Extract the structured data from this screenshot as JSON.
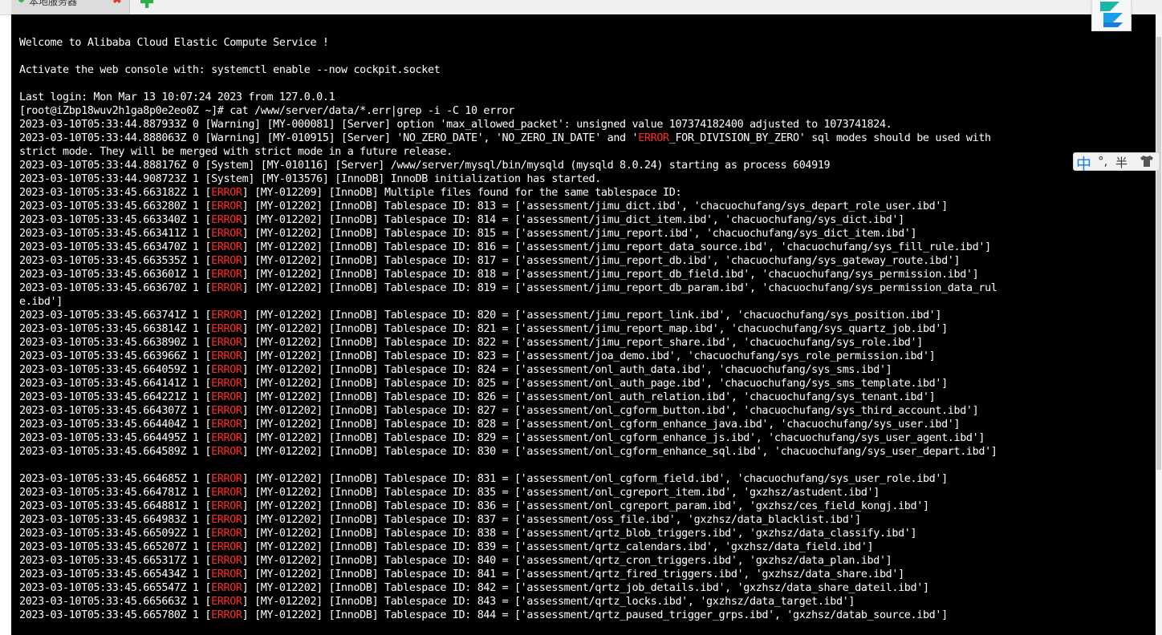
{
  "tab": {
    "title": "本地服务器",
    "close_glyph": "✖",
    "add_glyph": "✚",
    "status_color": "#3cb24a"
  },
  "ime": {
    "mode": "中",
    "punct": "°,",
    "width": "半"
  },
  "colors": {
    "terminal_bg": "#000000",
    "terminal_fg": "#ffffff",
    "error_highlight": "#ff2c2c"
  },
  "terminal": {
    "lines": [
      "Welcome to Alibaba Cloud Elastic Compute Service !",
      "",
      "Activate the web console with: systemctl enable --now cockpit.socket",
      "",
      "Last login: Mon Mar 13 10:07:24 2023 from 127.0.0.1",
      "[root@iZbp18wuv2h1ga8p0e2eo0Z ~]# cat /www/server/data/*.err|grep -i -C 10 error",
      "2023-03-10T05:33:44.887933Z 0 [Warning] [MY-000081] [Server] option 'max_allowed_packet': unsigned value 107374182400 adjusted to 1073741824.",
      "2023-03-10T05:33:44.888063Z 0 [Warning] [MY-010915] [Server] 'NO_ZERO_DATE', 'NO_ZERO_IN_DATE' and 'ERROR_FOR_DIVISION_BY_ZERO' sql modes should be used with",
      "strict mode. They will be merged with strict mode in a future release.",
      "2023-03-10T05:33:44.888176Z 0 [System] [MY-010116] [Server] /www/server/mysql/bin/mysqld (mysqld 8.0.24) starting as process 604919",
      "2023-03-10T05:33:44.908723Z 1 [System] [MY-013576] [InnoDB] InnoDB initialization has started.",
      "2023-03-10T05:33:45.663182Z 1 [ERROR] [MY-012209] [InnoDB] Multiple files found for the same tablespace ID:",
      "2023-03-10T05:33:45.663280Z 1 [ERROR] [MY-012202] [InnoDB] Tablespace ID: 813 = ['assessment/jimu_dict.ibd', 'chacuochufang/sys_depart_role_user.ibd']",
      "2023-03-10T05:33:45.663340Z 1 [ERROR] [MY-012202] [InnoDB] Tablespace ID: 814 = ['assessment/jimu_dict_item.ibd', 'chacuochufang/sys_dict.ibd']",
      "2023-03-10T05:33:45.663411Z 1 [ERROR] [MY-012202] [InnoDB] Tablespace ID: 815 = ['assessment/jimu_report.ibd', 'chacuochufang/sys_dict_item.ibd']",
      "2023-03-10T05:33:45.663470Z 1 [ERROR] [MY-012202] [InnoDB] Tablespace ID: 816 = ['assessment/jimu_report_data_source.ibd', 'chacuochufang/sys_fill_rule.ibd']",
      "2023-03-10T05:33:45.663535Z 1 [ERROR] [MY-012202] [InnoDB] Tablespace ID: 817 = ['assessment/jimu_report_db.ibd', 'chacuochufang/sys_gateway_route.ibd']",
      "2023-03-10T05:33:45.663601Z 1 [ERROR] [MY-012202] [InnoDB] Tablespace ID: 818 = ['assessment/jimu_report_db_field.ibd', 'chacuochufang/sys_permission.ibd']",
      "2023-03-10T05:33:45.663670Z 1 [ERROR] [MY-012202] [InnoDB] Tablespace ID: 819 = ['assessment/jimu_report_db_param.ibd', 'chacuochufang/sys_permission_data_rul",
      "e.ibd']",
      "2023-03-10T05:33:45.663741Z 1 [ERROR] [MY-012202] [InnoDB] Tablespace ID: 820 = ['assessment/jimu_report_link.ibd', 'chacuochufang/sys_position.ibd']",
      "2023-03-10T05:33:45.663814Z 1 [ERROR] [MY-012202] [InnoDB] Tablespace ID: 821 = ['assessment/jimu_report_map.ibd', 'chacuochufang/sys_quartz_job.ibd']",
      "2023-03-10T05:33:45.663890Z 1 [ERROR] [MY-012202] [InnoDB] Tablespace ID: 822 = ['assessment/jimu_report_share.ibd', 'chacuochufang/sys_role.ibd']",
      "2023-03-10T05:33:45.663966Z 1 [ERROR] [MY-012202] [InnoDB] Tablespace ID: 823 = ['assessment/joa_demo.ibd', 'chacuochufang/sys_role_permission.ibd']",
      "2023-03-10T05:33:45.664059Z 1 [ERROR] [MY-012202] [InnoDB] Tablespace ID: 824 = ['assessment/onl_auth_data.ibd', 'chacuochufang/sys_sms.ibd']",
      "2023-03-10T05:33:45.664141Z 1 [ERROR] [MY-012202] [InnoDB] Tablespace ID: 825 = ['assessment/onl_auth_page.ibd', 'chacuochufang/sys_sms_template.ibd']",
      "2023-03-10T05:33:45.664221Z 1 [ERROR] [MY-012202] [InnoDB] Tablespace ID: 826 = ['assessment/onl_auth_relation.ibd', 'chacuochufang/sys_tenant.ibd']",
      "2023-03-10T05:33:45.664307Z 1 [ERROR] [MY-012202] [InnoDB] Tablespace ID: 827 = ['assessment/onl_cgform_button.ibd', 'chacuochufang/sys_third_account.ibd']",
      "2023-03-10T05:33:45.664404Z 1 [ERROR] [MY-012202] [InnoDB] Tablespace ID: 828 = ['assessment/onl_cgform_enhance_java.ibd', 'chacuochufang/sys_user.ibd']",
      "2023-03-10T05:33:45.664495Z 1 [ERROR] [MY-012202] [InnoDB] Tablespace ID: 829 = ['assessment/onl_cgform_enhance_js.ibd', 'chacuochufang/sys_user_agent.ibd']",
      "2023-03-10T05:33:45.664589Z 1 [ERROR] [MY-012202] [InnoDB] Tablespace ID: 830 = ['assessment/onl_cgform_enhance_sql.ibd', 'chacuochufang/sys_user_depart.ibd']",
      "",
      "2023-03-10T05:33:45.664685Z 1 [ERROR] [MY-012202] [InnoDB] Tablespace ID: 831 = ['assessment/onl_cgform_field.ibd', 'chacuochufang/sys_user_role.ibd']",
      "2023-03-10T05:33:45.664781Z 1 [ERROR] [MY-012202] [InnoDB] Tablespace ID: 835 = ['assessment/onl_cgreport_item.ibd', 'gxzhsz/astudent.ibd']",
      "2023-03-10T05:33:45.664881Z 1 [ERROR] [MY-012202] [InnoDB] Tablespace ID: 836 = ['assessment/onl_cgreport_param.ibd', 'gxzhsz/ces_field_kongj.ibd']",
      "2023-03-10T05:33:45.664983Z 1 [ERROR] [MY-012202] [InnoDB] Tablespace ID: 837 = ['assessment/oss_file.ibd', 'gxzhsz/data_blacklist.ibd']",
      "2023-03-10T05:33:45.665092Z 1 [ERROR] [MY-012202] [InnoDB] Tablespace ID: 838 = ['assessment/qrtz_blob_triggers.ibd', 'gxzhsz/data_classify.ibd']",
      "2023-03-10T05:33:45.665207Z 1 [ERROR] [MY-012202] [InnoDB] Tablespace ID: 839 = ['assessment/qrtz_calendars.ibd', 'gxzhsz/data_field.ibd']",
      "2023-03-10T05:33:45.665317Z 1 [ERROR] [MY-012202] [InnoDB] Tablespace ID: 840 = ['assessment/qrtz_cron_triggers.ibd', 'gxzhsz/data_plan.ibd']",
      "2023-03-10T05:33:45.665434Z 1 [ERROR] [MY-012202] [InnoDB] Tablespace ID: 841 = ['assessment/qrtz_fired_triggers.ibd', 'gxzhsz/data_share.ibd']",
      "2023-03-10T05:33:45.665547Z 1 [ERROR] [MY-012202] [InnoDB] Tablespace ID: 842 = ['assessment/qrtz_job_details.ibd', 'gxzhsz/data_share_dateil.ibd']",
      "2023-03-10T05:33:45.665663Z 1 [ERROR] [MY-012202] [InnoDB] Tablespace ID: 843 = ['assessment/qrtz_locks.ibd', 'gxzhsz/data_target.ibd']",
      "2023-03-10T05:33:45.665780Z 1 [ERROR] [MY-012202] [InnoDB] Tablespace ID: 844 = ['assessment/qrtz_paused_trigger_grps.ibd', 'gxzhsz/datab_source.ibd']"
    ]
  }
}
